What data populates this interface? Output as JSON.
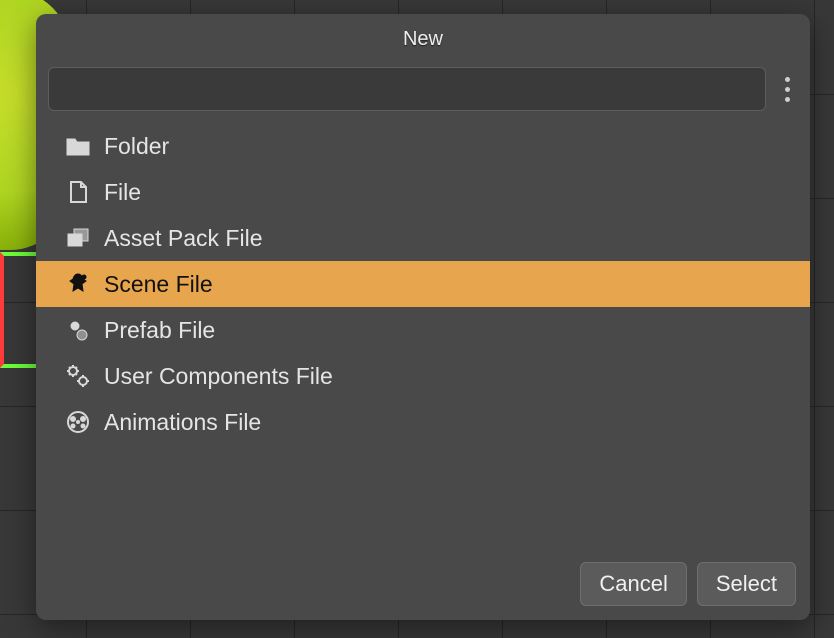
{
  "dialog": {
    "title": "New",
    "search_value": "",
    "search_placeholder": "",
    "menu_icon": "more-vertical"
  },
  "items": [
    {
      "icon": "folder-icon",
      "label": "Folder",
      "selected": false
    },
    {
      "icon": "file-icon",
      "label": "File",
      "selected": false
    },
    {
      "icon": "assetpack-icon",
      "label": "Asset Pack File",
      "selected": false
    },
    {
      "icon": "scene-icon",
      "label": "Scene File",
      "selected": true
    },
    {
      "icon": "prefab-icon",
      "label": "Prefab File",
      "selected": false
    },
    {
      "icon": "components-icon",
      "label": "User Components File",
      "selected": false
    },
    {
      "icon": "animations-icon",
      "label": "Animations File",
      "selected": false
    }
  ],
  "buttons": {
    "cancel": "Cancel",
    "select": "Select"
  },
  "colors": {
    "selection": "#e7a54d",
    "dialog_bg": "#494949",
    "panel_bg": "#3a3a3a"
  }
}
